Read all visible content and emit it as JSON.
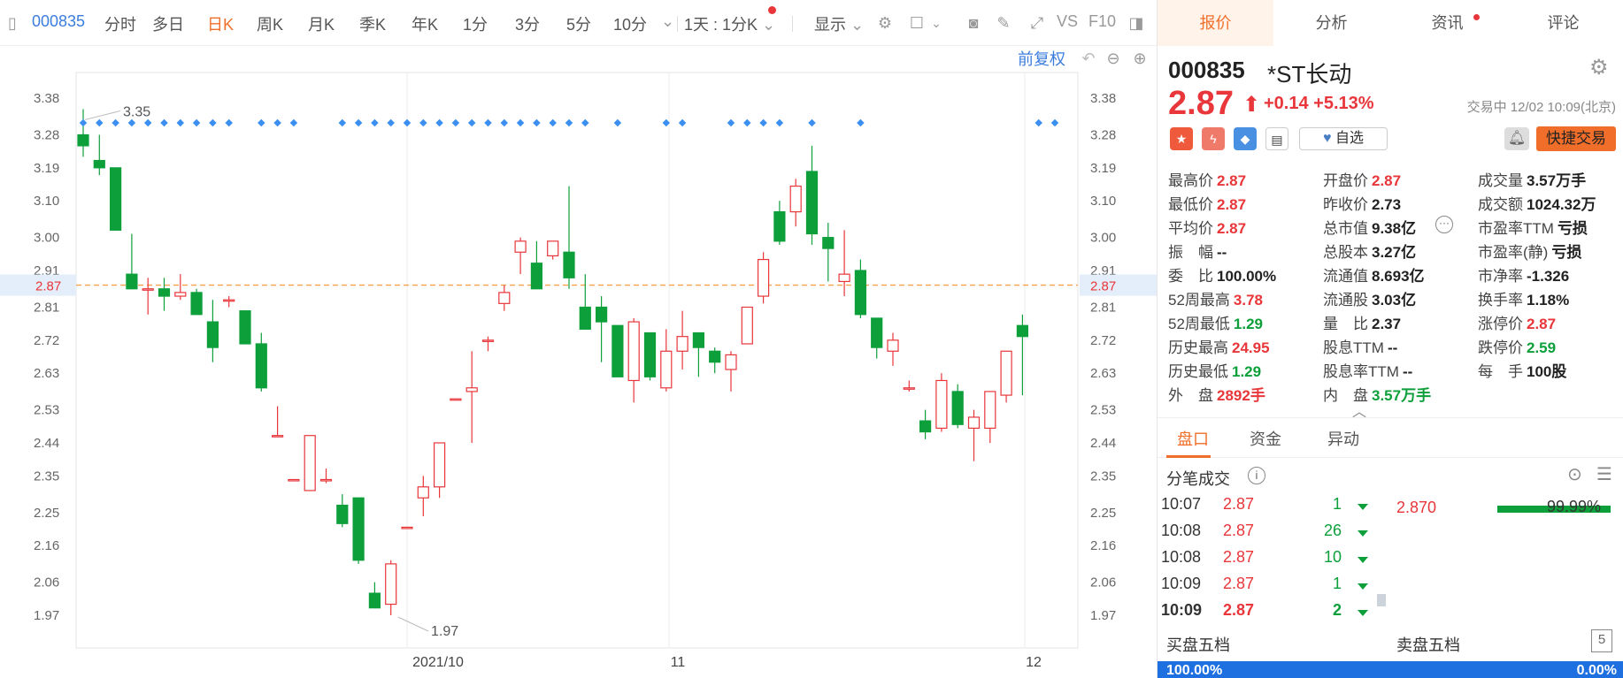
{
  "toolbar": {
    "code": "000835",
    "periods": [
      "分时",
      "多日",
      "日K",
      "周K",
      "月K",
      "季K",
      "年K",
      "1分",
      "3分",
      "5分",
      "10分"
    ],
    "active_period": "日K",
    "ratio_select": "1天 : 1分K",
    "display_select": "显示",
    "vs_label": "VS",
    "f10_label": "F10"
  },
  "chart": {
    "adjust_label": "前复权",
    "price_ticks": [
      "3.38",
      "3.28",
      "3.19",
      "3.10",
      "3.00",
      "2.91",
      "2.81",
      "2.72",
      "2.63",
      "2.53",
      "2.44",
      "2.35",
      "2.25",
      "2.16",
      "2.06",
      "1.97"
    ],
    "current_price_tag": "2.87",
    "date_labels": [
      "2021/10",
      "11",
      "12"
    ],
    "high_annotation": "3.35",
    "low_annotation": "1.97",
    "colors": {
      "up": "#e8363a",
      "down": "#0d9f3a",
      "marker": "#3b8ff0",
      "current": "#f6a04d"
    }
  },
  "chart_data": {
    "type": "candlestick",
    "ylim": [
      1.92,
      3.42
    ],
    "current_price": 2.87,
    "candles": [
      {
        "o": 3.28,
        "h": 3.35,
        "l": 3.22,
        "c": 3.25
      },
      {
        "o": 3.21,
        "h": 3.28,
        "l": 3.17,
        "c": 3.19
      },
      {
        "o": 3.19,
        "h": 3.19,
        "l": 3.02,
        "c": 3.02
      },
      {
        "o": 2.9,
        "h": 3.01,
        "l": 2.86,
        "c": 2.86
      },
      {
        "o": 2.86,
        "h": 2.89,
        "l": 2.79,
        "c": 2.86
      },
      {
        "o": 2.86,
        "h": 2.89,
        "l": 2.8,
        "c": 2.84
      },
      {
        "o": 2.84,
        "h": 2.9,
        "l": 2.83,
        "c": 2.85
      },
      {
        "o": 2.85,
        "h": 2.86,
        "l": 2.79,
        "c": 2.79
      },
      {
        "o": 2.77,
        "h": 2.83,
        "l": 2.66,
        "c": 2.7
      },
      {
        "o": 2.83,
        "h": 2.84,
        "l": 2.81,
        "c": 2.83
      },
      {
        "o": 2.8,
        "h": 2.8,
        "l": 2.71,
        "c": 2.71
      },
      {
        "o": 2.71,
        "h": 2.74,
        "l": 2.58,
        "c": 2.59
      },
      {
        "o": 2.46,
        "h": 2.54,
        "l": 2.46,
        "c": 2.46
      },
      {
        "o": 2.34,
        "h": 2.34,
        "l": 2.34,
        "c": 2.34
      },
      {
        "o": 2.31,
        "h": 2.46,
        "l": 2.31,
        "c": 2.46
      },
      {
        "o": 2.34,
        "h": 2.37,
        "l": 2.33,
        "c": 2.34
      },
      {
        "o": 2.27,
        "h": 2.3,
        "l": 2.21,
        "c": 2.22
      },
      {
        "o": 2.29,
        "h": 2.29,
        "l": 2.11,
        "c": 2.12
      },
      {
        "o": 2.03,
        "h": 2.06,
        "l": 1.99,
        "c": 1.99
      },
      {
        "o": 2.0,
        "h": 2.12,
        "l": 1.97,
        "c": 2.11
      },
      {
        "o": 2.21,
        "h": 2.21,
        "l": 2.21,
        "c": 2.21
      },
      {
        "o": 2.29,
        "h": 2.35,
        "l": 2.24,
        "c": 2.32
      },
      {
        "o": 2.32,
        "h": 2.44,
        "l": 2.29,
        "c": 2.44
      },
      {
        "o": 2.56,
        "h": 2.56,
        "l": 2.56,
        "c": 2.56
      },
      {
        "o": 2.58,
        "h": 2.69,
        "l": 2.44,
        "c": 2.59
      },
      {
        "o": 2.72,
        "h": 2.73,
        "l": 2.69,
        "c": 2.72
      },
      {
        "o": 2.82,
        "h": 2.87,
        "l": 2.8,
        "c": 2.85
      },
      {
        "o": 2.96,
        "h": 3.0,
        "l": 2.9,
        "c": 2.99
      },
      {
        "o": 2.93,
        "h": 2.99,
        "l": 2.86,
        "c": 2.86
      },
      {
        "o": 2.95,
        "h": 2.99,
        "l": 2.94,
        "c": 2.99
      },
      {
        "o": 2.96,
        "h": 3.14,
        "l": 2.86,
        "c": 2.89
      },
      {
        "o": 2.81,
        "h": 2.9,
        "l": 2.75,
        "c": 2.75
      },
      {
        "o": 2.81,
        "h": 2.84,
        "l": 2.66,
        "c": 2.77
      },
      {
        "o": 2.76,
        "h": 2.76,
        "l": 2.62,
        "c": 2.62
      },
      {
        "o": 2.61,
        "h": 2.78,
        "l": 2.55,
        "c": 2.77
      },
      {
        "o": 2.74,
        "h": 2.74,
        "l": 2.61,
        "c": 2.62
      },
      {
        "o": 2.59,
        "h": 2.75,
        "l": 2.58,
        "c": 2.69
      },
      {
        "o": 2.69,
        "h": 2.8,
        "l": 2.64,
        "c": 2.73
      },
      {
        "o": 2.74,
        "h": 2.74,
        "l": 2.62,
        "c": 2.7
      },
      {
        "o": 2.69,
        "h": 2.7,
        "l": 2.63,
        "c": 2.66
      },
      {
        "o": 2.64,
        "h": 2.69,
        "l": 2.58,
        "c": 2.68
      },
      {
        "o": 2.71,
        "h": 2.81,
        "l": 2.71,
        "c": 2.81
      },
      {
        "o": 2.84,
        "h": 2.96,
        "l": 2.82,
        "c": 2.94
      },
      {
        "o": 3.07,
        "h": 3.1,
        "l": 2.98,
        "c": 2.99
      },
      {
        "o": 3.07,
        "h": 3.16,
        "l": 3.03,
        "c": 3.14
      },
      {
        "o": 3.18,
        "h": 3.25,
        "l": 2.98,
        "c": 3.01
      },
      {
        "o": 3.0,
        "h": 3.04,
        "l": 2.88,
        "c": 2.97
      },
      {
        "o": 2.88,
        "h": 3.02,
        "l": 2.84,
        "c": 2.9
      },
      {
        "o": 2.91,
        "h": 2.94,
        "l": 2.78,
        "c": 2.79
      },
      {
        "o": 2.78,
        "h": 2.78,
        "l": 2.67,
        "c": 2.7
      },
      {
        "o": 2.69,
        "h": 2.74,
        "l": 2.65,
        "c": 2.72
      },
      {
        "o": 2.59,
        "h": 2.61,
        "l": 2.58,
        "c": 2.59
      },
      {
        "o": 2.5,
        "h": 2.53,
        "l": 2.45,
        "c": 2.47
      },
      {
        "o": 2.48,
        "h": 2.63,
        "l": 2.47,
        "c": 2.61
      },
      {
        "o": 2.58,
        "h": 2.6,
        "l": 2.48,
        "c": 2.49
      },
      {
        "o": 2.48,
        "h": 2.53,
        "l": 2.39,
        "c": 2.51
      },
      {
        "o": 2.48,
        "h": 2.58,
        "l": 2.44,
        "c": 2.58
      },
      {
        "o": 2.57,
        "h": 2.69,
        "l": 2.55,
        "c": 2.69
      },
      {
        "o": 2.76,
        "h": 2.79,
        "l": 2.57,
        "c": 2.73
      }
    ],
    "marker_indices": [
      0,
      1,
      2,
      3,
      4,
      5,
      6,
      7,
      8,
      9,
      11,
      12,
      13,
      16,
      17,
      18,
      19,
      20,
      21,
      22,
      23,
      24,
      25,
      26,
      27,
      28,
      29,
      30,
      31,
      33,
      36,
      37,
      40,
      41,
      42,
      43,
      45,
      48,
      59,
      60
    ]
  },
  "panel": {
    "tabs": [
      "报价",
      "分析",
      "资讯",
      "评论"
    ],
    "active_tab": "报价",
    "code": "000835",
    "name": "*ST长动",
    "price": "2.87",
    "change": "+0.14",
    "change_pct": "+5.13%",
    "status": "交易中 12/02 10:09(北京)",
    "fav_label": "自选",
    "quick_trade": "快捷交易",
    "quotes": [
      [
        {
          "l": "最高价",
          "v": "2.87",
          "c": "red"
        },
        {
          "l": "开盘价",
          "v": "2.87",
          "c": "red"
        },
        {
          "l": "成交量",
          "v": "3.57万手",
          "c": "dark"
        }
      ],
      [
        {
          "l": "最低价",
          "v": "2.87",
          "c": "red"
        },
        {
          "l": "昨收价",
          "v": "2.73",
          "c": "dark"
        },
        {
          "l": "成交额",
          "v": "1024.32万",
          "c": "dark"
        }
      ],
      [
        {
          "l": "平均价",
          "v": "2.87",
          "c": "red"
        },
        {
          "l": "总市值",
          "v": "9.38亿",
          "c": "dark"
        },
        {
          "l": "市盈率TTM",
          "v": "亏损",
          "c": "dark"
        }
      ],
      [
        {
          "l": "振　幅",
          "v": "--",
          "c": "dark"
        },
        {
          "l": "总股本",
          "v": "3.27亿",
          "c": "dark"
        },
        {
          "l": "市盈率(静)",
          "v": "亏损",
          "c": "dark"
        }
      ],
      [
        {
          "l": "委　比",
          "v": "100.00%",
          "c": "dark"
        },
        {
          "l": "流通值",
          "v": "8.693亿",
          "c": "dark"
        },
        {
          "l": "市净率",
          "v": "-1.326",
          "c": "dark"
        }
      ],
      [
        {
          "l": "52周最高",
          "v": "3.78",
          "c": "red"
        },
        {
          "l": "流通股",
          "v": "3.03亿",
          "c": "dark"
        },
        {
          "l": "换手率",
          "v": "1.18%",
          "c": "dark"
        }
      ],
      [
        {
          "l": "52周最低",
          "v": "1.29",
          "c": "green"
        },
        {
          "l": "量　比",
          "v": "2.37",
          "c": "dark"
        },
        {
          "l": "涨停价",
          "v": "2.87",
          "c": "red"
        }
      ],
      [
        {
          "l": "历史最高",
          "v": "24.95",
          "c": "red"
        },
        {
          "l": "股息TTM",
          "v": "--",
          "c": "dark"
        },
        {
          "l": "跌停价",
          "v": "2.59",
          "c": "green"
        }
      ],
      [
        {
          "l": "历史最低",
          "v": "1.29",
          "c": "green"
        },
        {
          "l": "股息率TTM",
          "v": "--",
          "c": "dark"
        },
        {
          "l": "每　手",
          "v": "100股",
          "c": "dark"
        }
      ],
      [
        {
          "l": "外　盘",
          "v": "2892手",
          "c": "red"
        },
        {
          "l": "内　盘",
          "v": "3.57万手",
          "c": "green"
        }
      ]
    ],
    "subtabs": [
      "盘口",
      "资金",
      "异动"
    ],
    "ticks_title": "分笔成交",
    "ticks": [
      {
        "t": "10:07",
        "p": "2.87",
        "q": "1"
      },
      {
        "t": "10:08",
        "p": "2.87",
        "q": "26"
      },
      {
        "t": "10:08",
        "p": "2.87",
        "q": "10"
      },
      {
        "t": "10:09",
        "p": "2.87",
        "q": "1"
      },
      {
        "t": "10:09",
        "p": "2.87",
        "q": "2"
      }
    ],
    "bid_price": "2.870",
    "bid_pct": "99.99%",
    "buy_five": "买盘五档",
    "sell_five": "卖盘五档",
    "buy_pct": "100.00%",
    "sell_pct": "0.00%"
  }
}
